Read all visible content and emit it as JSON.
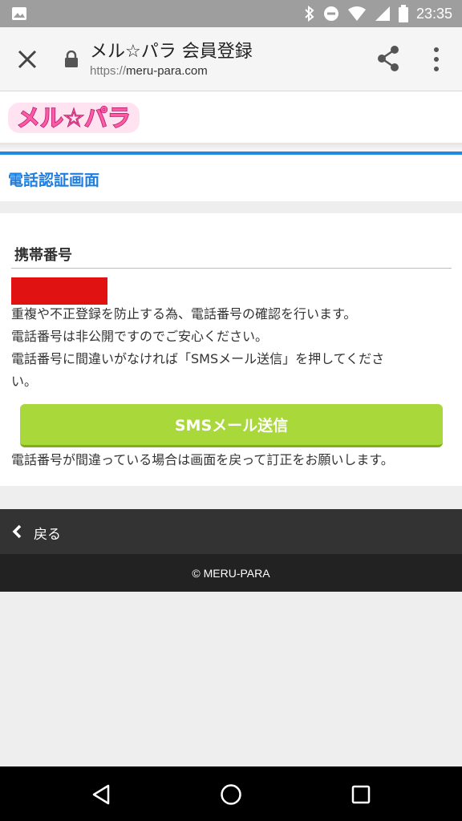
{
  "status_bar": {
    "time": "23:35",
    "icons": [
      "image-icon",
      "bluetooth-icon",
      "do-not-disturb-icon",
      "wifi-icon",
      "signal-icon",
      "battery-icon"
    ]
  },
  "browser": {
    "title": "メル☆パラ 会員登録",
    "url_scheme": "https://",
    "url_host": "meru-para.com"
  },
  "site": {
    "logo_text": "メル☆パラ",
    "section_title": "電話認証画面"
  },
  "form": {
    "phone_label": "携帯番号",
    "description_lines": [
      "重複や不正登録を防止する為、電話番号の確認を行います。",
      "電話番号は非公開ですのでご安心ください。",
      "電話番号に間違いがなければ「SMSメール送信」を押してくださ\nい。"
    ],
    "sms_button_label": "SMSメール送信",
    "note": "電話番号が間違っている場合は画面を戻って訂正をお願いします。"
  },
  "back_bar": {
    "label": "戻る"
  },
  "footer": {
    "copyright": "© MERU-PARA"
  },
  "colors": {
    "accent_blue": "#1e88e5",
    "button_green": "#a8d83a",
    "redaction_red": "#e01212",
    "logo_pink": "#ff5aa5"
  }
}
